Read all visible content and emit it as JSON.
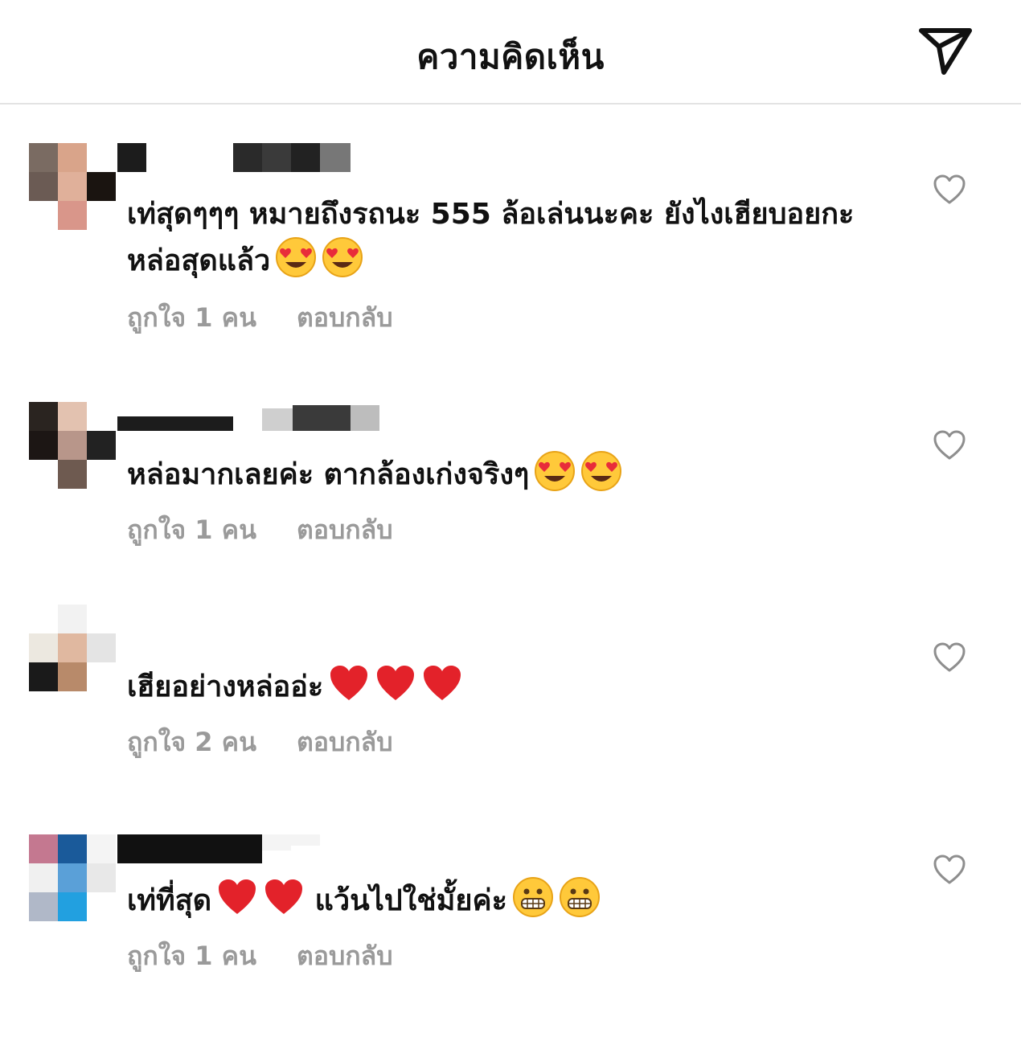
{
  "header": {
    "title": "ความคิดเห็น",
    "send_icon": "send-icon"
  },
  "comments": [
    {
      "text": "เท่สุดๆๆๆ หมายถึงรถนะ 555 ล้อเล่นนะคะ ยังไงเฮียบอยกะหล่อสุดแล้ว",
      "emojis": [
        "heart-eyes-emoji",
        "heart-eyes-emoji"
      ],
      "likes": "ถูกใจ 1 คน",
      "reply": "ตอบกลับ",
      "like_icon": "heart-outline-icon"
    },
    {
      "text": "หล่อมากเลยค่ะ ตากล้องเก่งจริงๆ",
      "emojis": [
        "heart-eyes-emoji",
        "heart-eyes-emoji"
      ],
      "likes": "ถูกใจ 1 คน",
      "reply": "ตอบกลับ",
      "like_icon": "heart-outline-icon"
    },
    {
      "text": "เฮียอย่างหล่ออ่ะ",
      "emojis": [
        "red-heart-emoji",
        "red-heart-emoji",
        "red-heart-emoji"
      ],
      "likes": "ถูกใจ 2 คน",
      "reply": "ตอบกลับ",
      "like_icon": "heart-outline-icon"
    },
    {
      "text_before": "เท่ที่สุด",
      "emojis_mid": [
        "red-heart-emoji",
        "red-heart-emoji"
      ],
      "text_after": "แว้นไปใช่มั้ยค่ะ",
      "emojis": [
        "grimacing-emoji",
        "grimacing-emoji"
      ],
      "likes": "ถูกใจ 1 คน",
      "reply": "ตอบกลับ",
      "like_icon": "heart-outline-icon"
    }
  ],
  "colors": {
    "text": "#111111",
    "meta": "#9a9a9a",
    "divider": "#e3e3e3"
  }
}
